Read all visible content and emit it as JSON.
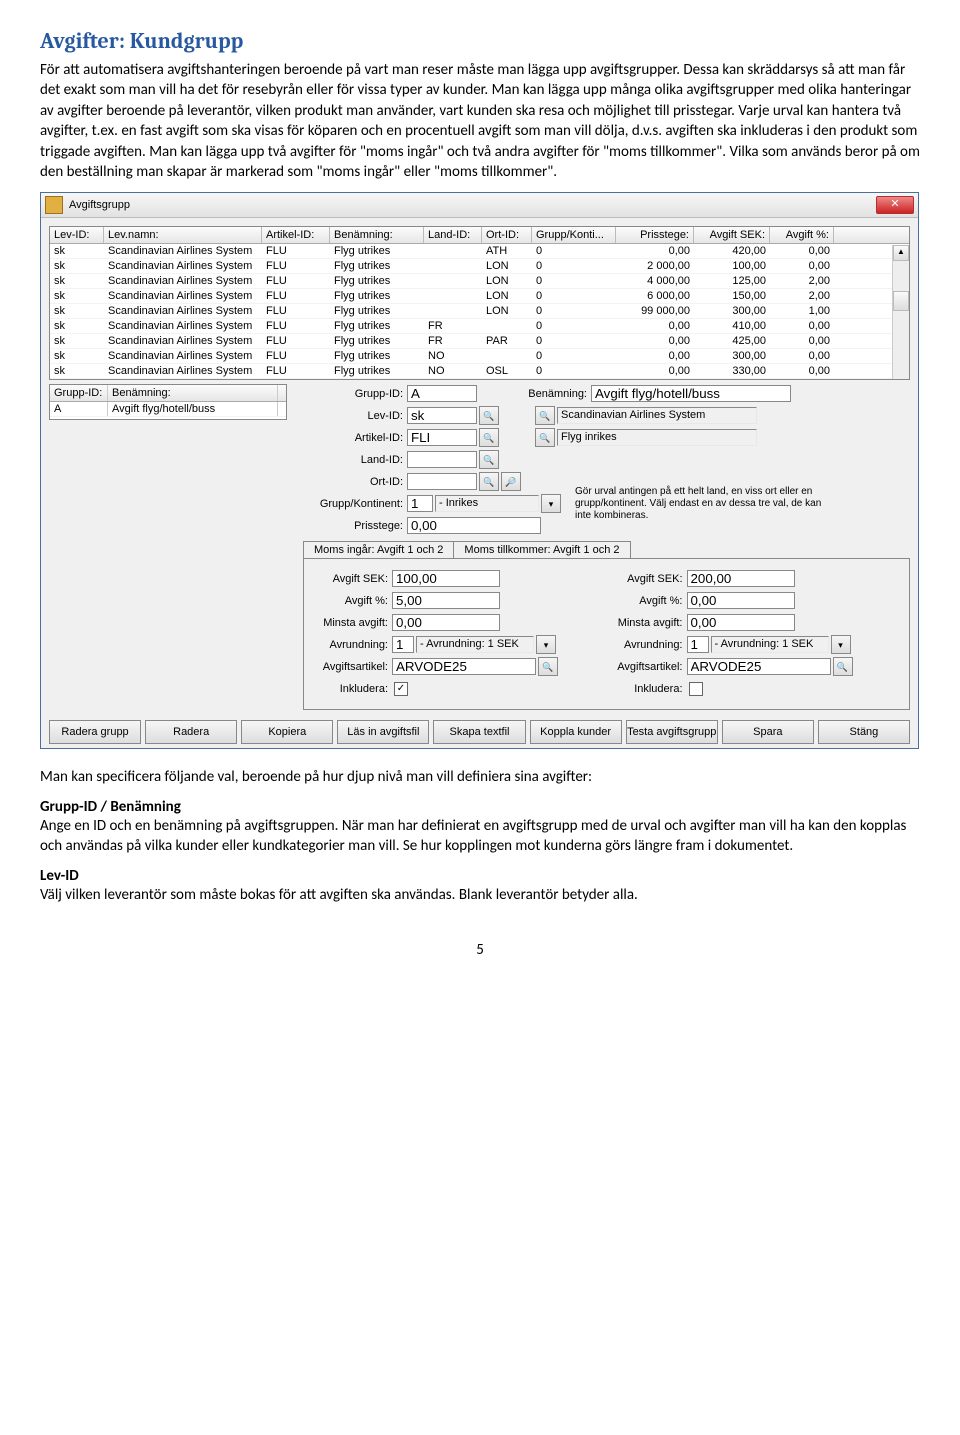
{
  "page": {
    "title": "Avgifter: Kundgrupp",
    "intro": "För att automatisera avgiftshanteringen beroende på vart man reser måste man lägga upp avgiftsgrupper. Dessa kan skräddarsys så att man får det exakt som man vill ha det för resebyrån eller för vissa typer av kunder. Man kan lägga upp många olika avgiftsgrupper med olika hanteringar av avgifter beroende på leverantör, vilken produkt man använder, vart kunden ska resa och möjlighet till prisstegar. Varje urval kan hantera två avgifter, t.ex. en fast avgift som ska visas för köparen och en procentuell avgift som man vill dölja, d.v.s. avgiften ska inkluderas i den produkt som triggade avgiften. Man kan lägga upp två avgifter för \"moms ingår\" och två andra avgifter för \"moms tillkommer\". Vilka som används beror på om den beställning man skapar är markerad som \"moms ingår\" eller \"moms tillkommer\".",
    "aftertext": "Man kan specificera följande val, beroende på hur djup nivå man vill definiera sina avgifter:",
    "h2a": "Grupp-ID / Benämning",
    "pa": "Ange en ID och en benämning på avgiftsgruppen. När man har definierat en avgiftsgrupp med de urval och avgifter man vill ha kan den kopplas och användas på vilka kunder eller kundkategorier man vill. Se hur kopplingen mot kunderna görs längre fram i dokumentet.",
    "h2b": "Lev-ID",
    "pb": "Välj vilken leverantör som måste bokas för att avgiften ska användas. Blank leverantör betyder alla.",
    "pagenum": "5"
  },
  "dlg": {
    "title": "Avgiftsgrupp",
    "close": "✕",
    "headers": {
      "lev": "Lev-ID:",
      "levn": "Lev.namn:",
      "art": "Artikel-ID:",
      "ben": "Benämning:",
      "land": "Land-ID:",
      "ort": "Ort-ID:",
      "grk": "Grupp/Konti...",
      "pris": "Prisstege:",
      "sek": "Avgift SEK:",
      "pct": "Avgift %:"
    },
    "rows": [
      {
        "lev": "sk",
        "levn": "Scandinavian Airlines System",
        "art": "FLU",
        "ben": "Flyg utrikes",
        "land": "",
        "ort": "ATH",
        "grk": "0",
        "pris": "0,00",
        "sek": "420,00",
        "pct": "0,00"
      },
      {
        "lev": "sk",
        "levn": "Scandinavian Airlines System",
        "art": "FLU",
        "ben": "Flyg utrikes",
        "land": "",
        "ort": "LON",
        "grk": "0",
        "pris": "2 000,00",
        "sek": "100,00",
        "pct": "0,00"
      },
      {
        "lev": "sk",
        "levn": "Scandinavian Airlines System",
        "art": "FLU",
        "ben": "Flyg utrikes",
        "land": "",
        "ort": "LON",
        "grk": "0",
        "pris": "4 000,00",
        "sek": "125,00",
        "pct": "2,00"
      },
      {
        "lev": "sk",
        "levn": "Scandinavian Airlines System",
        "art": "FLU",
        "ben": "Flyg utrikes",
        "land": "",
        "ort": "LON",
        "grk": "0",
        "pris": "6 000,00",
        "sek": "150,00",
        "pct": "2,00"
      },
      {
        "lev": "sk",
        "levn": "Scandinavian Airlines System",
        "art": "FLU",
        "ben": "Flyg utrikes",
        "land": "",
        "ort": "LON",
        "grk": "0",
        "pris": "99 000,00",
        "sek": "300,00",
        "pct": "1,00"
      },
      {
        "lev": "sk",
        "levn": "Scandinavian Airlines System",
        "art": "FLU",
        "ben": "Flyg utrikes",
        "land": "FR",
        "ort": "",
        "grk": "0",
        "pris": "0,00",
        "sek": "410,00",
        "pct": "0,00"
      },
      {
        "lev": "sk",
        "levn": "Scandinavian Airlines System",
        "art": "FLU",
        "ben": "Flyg utrikes",
        "land": "FR",
        "ort": "PAR",
        "grk": "0",
        "pris": "0,00",
        "sek": "425,00",
        "pct": "0,00"
      },
      {
        "lev": "sk",
        "levn": "Scandinavian Airlines System",
        "art": "FLU",
        "ben": "Flyg utrikes",
        "land": "NO",
        "ort": "",
        "grk": "0",
        "pris": "0,00",
        "sek": "300,00",
        "pct": "0,00"
      },
      {
        "lev": "sk",
        "levn": "Scandinavian Airlines System",
        "art": "FLU",
        "ben": "Flyg utrikes",
        "land": "NO",
        "ort": "OSL",
        "grk": "0",
        "pris": "0,00",
        "sek": "330,00",
        "pct": "0,00"
      }
    ],
    "mini": {
      "h1": "Grupp-ID:",
      "h2": "Benämning:",
      "r1": "A",
      "r2": "Avgift flyg/hotell/buss"
    },
    "form": {
      "grp": "Grupp-ID:",
      "grpv": "A",
      "benlab": "Benämning:",
      "benv": "Avgift flyg/hotell/buss",
      "lev": "Lev-ID:",
      "levv": "sk",
      "levname": "Scandinavian Airlines System",
      "art": "Artikel-ID:",
      "artv": "FLI",
      "artname": "Flyg inrikes",
      "land": "Land-ID:",
      "landv": "",
      "ort": "Ort-ID:",
      "ortv": "",
      "grk": "Grupp/Kontinent:",
      "grkv": "1",
      "grkname": "- Inrikes",
      "pris": "Prisstege:",
      "prisv": "0,00",
      "hint": "Gör urval antingen på ett helt land, en viss ort eller en grupp/kontinent. Välj endast en av dessa tre val, de kan inte kombineras."
    },
    "tabs": {
      "t1": "Moms ingår: Avgift 1 och 2",
      "t2": "Moms tillkommer: Avgift 1 och 2"
    },
    "tp": {
      "sek": "Avgift SEK:",
      "pct": "Avgift %:",
      "min": "Minsta avgift:",
      "avr": "Avrundning:",
      "avrt": "- Avrundning: 1 SEK",
      "art": "Avgiftsartikel:",
      "ink": "Inkludera:",
      "c1": {
        "sek": "100,00",
        "pct": "5,00",
        "min": "0,00",
        "avr": "1",
        "art": "ARVODE25",
        "chk": "✓"
      },
      "c2": {
        "sek": "200,00",
        "pct": "0,00",
        "min": "0,00",
        "avr": "1",
        "art": "ARVODE25",
        "chk": ""
      }
    },
    "btns": {
      "radg": "Radera grupp",
      "rad": "Radera",
      "kop": "Kopiera",
      "las": "Läs in avgiftsfil",
      "ska": "Skapa textfil",
      "kopk": "Koppla kunder",
      "tes": "Testa avgiftsgrupp",
      "spa": "Spara",
      "sta": "Stäng"
    }
  }
}
